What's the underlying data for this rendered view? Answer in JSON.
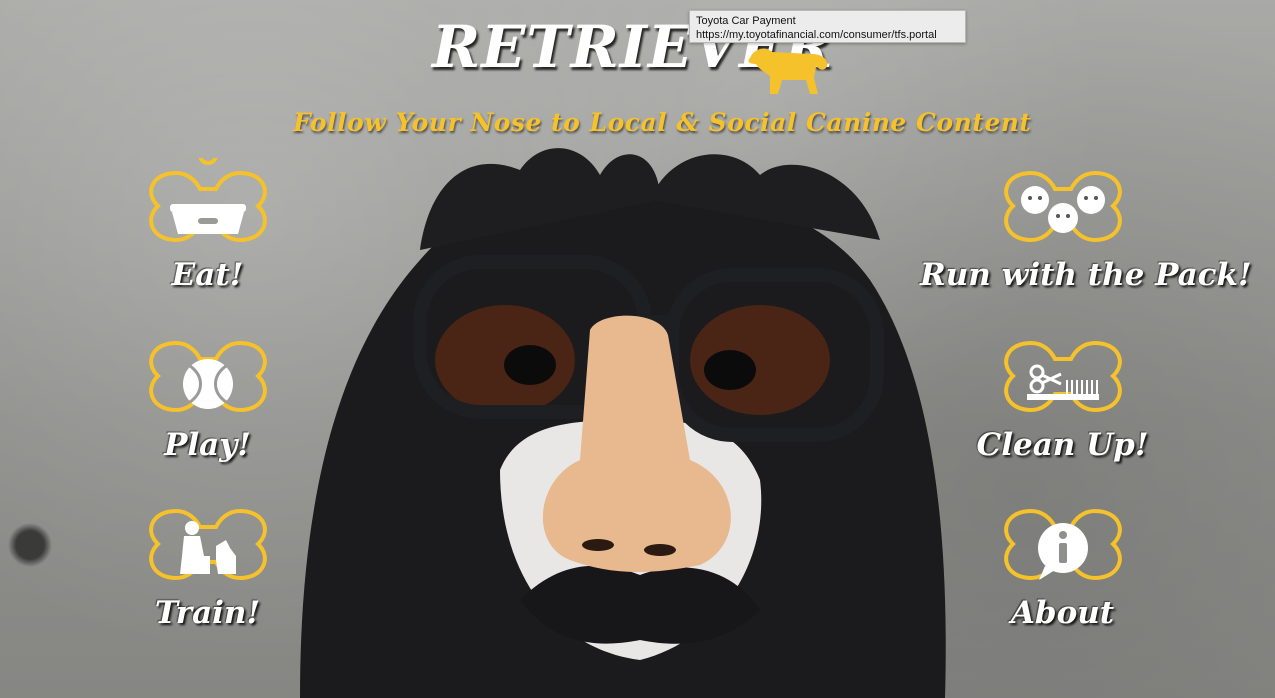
{
  "header": {
    "title": "RETRIEVER",
    "tagline": "Follow Your Nose to Local & Social Canine Content",
    "logo_icon": "golden-retriever-icon"
  },
  "tooltip": {
    "title": "Toyota Car Payment",
    "url": "https://my.toyotafinancial.com/consumer/tfs.portal"
  },
  "nav": {
    "eat": {
      "label": "Eat!",
      "icon": "dog-bowl-icon"
    },
    "play": {
      "label": "Play!",
      "icon": "tennis-ball-icon"
    },
    "train": {
      "label": "Train!",
      "icon": "trainer-dog-icon"
    },
    "pack": {
      "label": "Run with the Pack!",
      "icon": "dog-pack-icon"
    },
    "clean": {
      "label": "Clean Up!",
      "icon": "scissors-comb-icon"
    },
    "about": {
      "label": "About",
      "icon": "info-icon"
    }
  },
  "colors": {
    "accent": "#f5c22c",
    "text": "#ffffff"
  }
}
